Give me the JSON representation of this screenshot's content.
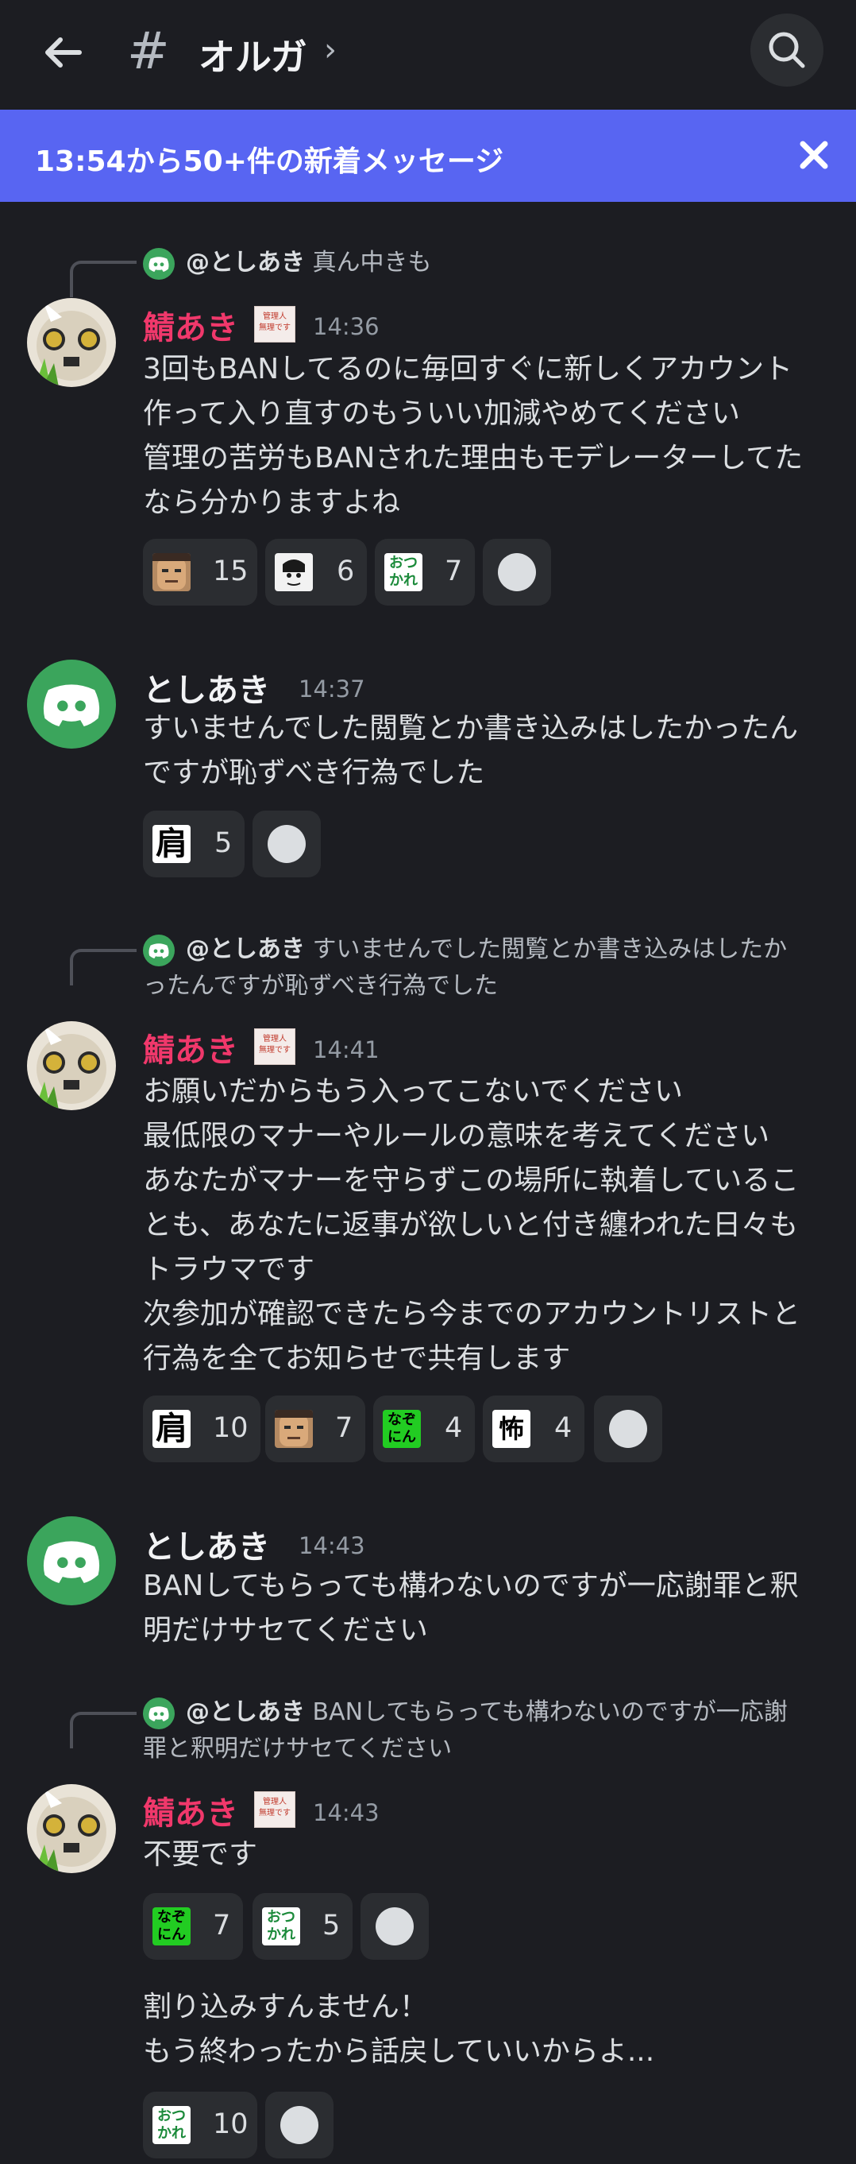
{
  "header": {
    "channel_name": "オルガ",
    "hash": "#",
    "chevron": "›",
    "back_icon": "back-arrow-icon",
    "search_icon": "search-icon"
  },
  "banner": {
    "text": "13:54から50+件の新着メッセージ",
    "color": "#5865f2"
  },
  "colors": {
    "background": "#1c1d22",
    "pink_author": "#f0386b",
    "discord_green": "#3ba55c"
  },
  "messages": [
    {
      "reply_to": {
        "name": "@としあき",
        "text": "真ん中きも"
      },
      "author": "鯖あき",
      "role_badge": "管理人 無理です",
      "time": "14:36",
      "lines": "3回もBANしてるのに毎回すぐに新しくアカウント\n作って入り直すのもういい加減やめてください\n管理の苦労もBANされた理由もモデレーターしてた\nなら分かりますよね",
      "reactions": [
        {
          "emoji": "face-emoji",
          "count": "15"
        },
        {
          "emoji": "manga-emoji",
          "count": "6"
        },
        {
          "emoji": "otsukare-emoji",
          "count": "7"
        }
      ]
    },
    {
      "author": "としあき",
      "time": "14:37",
      "lines": "すいませんでした閲覧とか書き込みはしたかったん\nですが恥ずべき行為でした",
      "reactions": [
        {
          "emoji": "kata-emoji",
          "label": "肩",
          "count": "5"
        }
      ]
    },
    {
      "reply_to": {
        "name": "@としあき",
        "text": "すいませんでした閲覧とか書き込みはしたか",
        "text2": "ったんですが恥ずべき行為でした"
      },
      "author": "鯖あき",
      "role_badge": "管理人 無理です",
      "time": "14:41",
      "lines": "お願いだからもう入ってこないでください\n最低限のマナーやルールの意味を考えてください\nあなたがマナーを守らずこの場所に執着しているこ\nとも、あなたに返事が欲しいと付き纏われた日々も\nトラウマです\n次参加が確認できたら今までのアカウントリストと\n行為を全てお知らせで共有します",
      "reactions": [
        {
          "emoji": "kata-emoji",
          "label": "肩",
          "count": "10"
        },
        {
          "emoji": "face-emoji",
          "count": "7"
        },
        {
          "emoji": "nazonin-emoji",
          "count": "4"
        },
        {
          "emoji": "kowai-emoji",
          "label": "怖",
          "count": "4"
        }
      ]
    },
    {
      "author": "としあき",
      "time": "14:43",
      "lines": "BANしてもらっても構わないのですが一応謝罪と釈\n明だけサセてください"
    },
    {
      "reply_to": {
        "name": "@としあき",
        "text": "BANしてもらっても構わないのですが一応謝",
        "text2": "罪と釈明だけサセてください"
      },
      "author": "鯖あき",
      "role_badge": "管理人 無理です",
      "time": "14:43",
      "lines": "不要です",
      "reactions": [
        {
          "emoji": "nazonin-emoji",
          "count": "7"
        },
        {
          "emoji": "otsukare-emoji",
          "count": "5"
        }
      ],
      "followup": "割り込みすんません！\nもう終わったから話戻していいからよ...",
      "followup_reactions": [
        {
          "emoji": "otsukare-emoji",
          "count": "10"
        }
      ]
    }
  ],
  "emoji_text": {
    "otsukare": "おつかれ",
    "nazonin": "なぞにん",
    "role_line1": "管理人",
    "role_line2": "無理です"
  }
}
